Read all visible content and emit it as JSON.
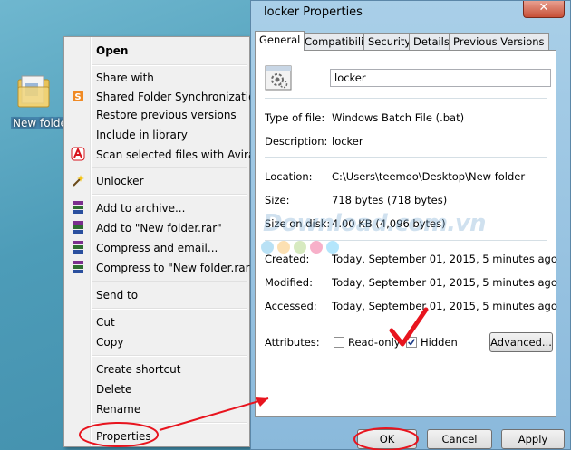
{
  "desktop": {
    "folder_label": "New folder"
  },
  "context_menu": {
    "items": [
      {
        "label": "Open",
        "bold": true
      },
      {
        "label": "Share with"
      },
      {
        "label": "Shared Folder Synchronization"
      },
      {
        "label": "Restore previous versions"
      },
      {
        "label": "Include in library"
      },
      {
        "label": "Scan selected files with Avira"
      },
      {
        "label": "Unlocker"
      },
      {
        "label": "Add to archive..."
      },
      {
        "label": "Add to \"New folder.rar\""
      },
      {
        "label": "Compress and email..."
      },
      {
        "label": "Compress to \"New folder.rar\" ar"
      },
      {
        "label": "Send to"
      },
      {
        "label": "Cut"
      },
      {
        "label": "Copy"
      },
      {
        "label": "Create shortcut"
      },
      {
        "label": "Delete"
      },
      {
        "label": "Rename"
      },
      {
        "label": "Properties"
      }
    ]
  },
  "dialog": {
    "title": "locker Properties",
    "close_glyph": "✕",
    "tabs": [
      "General",
      "Compatibility",
      "Security",
      "Details",
      "Previous Versions"
    ],
    "file_name": "locker",
    "type_of_file": {
      "label": "Type of file:",
      "value": "Windows Batch File (.bat)"
    },
    "description": {
      "label": "Description:",
      "value": "locker"
    },
    "location": {
      "label": "Location:",
      "value": "C:\\Users\\teemoo\\Desktop\\New folder"
    },
    "size": {
      "label": "Size:",
      "value": "718 bytes (718 bytes)"
    },
    "size_on_disk": {
      "label": "Size on disk:",
      "value": "4.00 KB (4,096 bytes)"
    },
    "created": {
      "label": "Created:",
      "value": "Today, September 01, 2015, 5 minutes ago"
    },
    "modified": {
      "label": "Modified:",
      "value": "Today, September 01, 2015, 5 minutes ago"
    },
    "accessed": {
      "label": "Accessed:",
      "value": "Today, September 01, 2015, 5 minutes ago"
    },
    "attributes": {
      "label": "Attributes:",
      "readonly": "Read-only",
      "hidden": "Hidden",
      "advanced": "Advanced..."
    },
    "buttons": {
      "ok": "OK",
      "cancel": "Cancel",
      "apply": "Apply"
    }
  },
  "watermark": {
    "text": "Download.com.vn"
  },
  "colors": {
    "annotation_red": "#e8141e",
    "avira_red": "#d8141c",
    "dot_colors": [
      "#36a9e1",
      "#f5a623",
      "#8bc34a",
      "#e91e63",
      "#29b6f6"
    ]
  }
}
